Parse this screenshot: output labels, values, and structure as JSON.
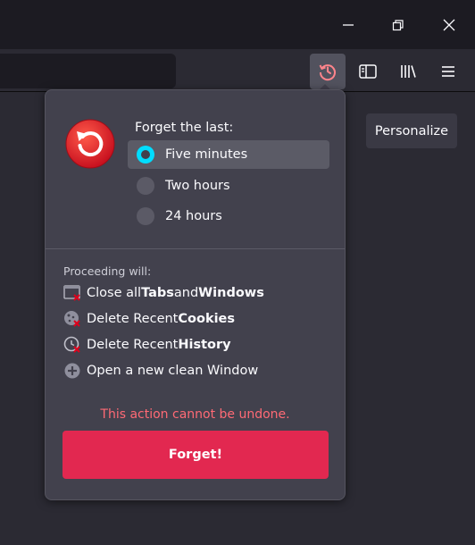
{
  "window": {
    "minimize_icon": "minimize-icon",
    "restore_icon": "restore-icon",
    "close_icon": "close-icon"
  },
  "toolbar": {
    "forget_icon": "forget-history-icon",
    "sidebar_icon": "sidebar-icon",
    "library_icon": "library-icon",
    "menu_icon": "hamburger-menu-icon",
    "personalize_label": "Personalize"
  },
  "panel": {
    "forget_label": "Forget the last:",
    "options": [
      {
        "label": "Five minutes",
        "selected": true
      },
      {
        "label": "Two hours",
        "selected": false
      },
      {
        "label": "24 hours",
        "selected": false
      }
    ],
    "proceeding_label": "Proceeding will:",
    "actions": [
      {
        "icon": "close-window-icon",
        "prefix": "Close all ",
        "bold1": "Tabs",
        "middle": " and ",
        "bold2": "Windows"
      },
      {
        "icon": "cookie-delete-icon",
        "prefix": "Delete Recent ",
        "bold1": "Cookies"
      },
      {
        "icon": "history-delete-icon",
        "prefix": "Delete Recent ",
        "bold1": "History"
      },
      {
        "icon": "add-window-icon",
        "prefix": "Open a new clean Window"
      }
    ],
    "warning": "This action cannot be undone.",
    "forget_button": "Forget!"
  },
  "colors": {
    "accent": "#00ddff",
    "danger_button": "#e22850",
    "warning_text": "#ff6a75"
  }
}
